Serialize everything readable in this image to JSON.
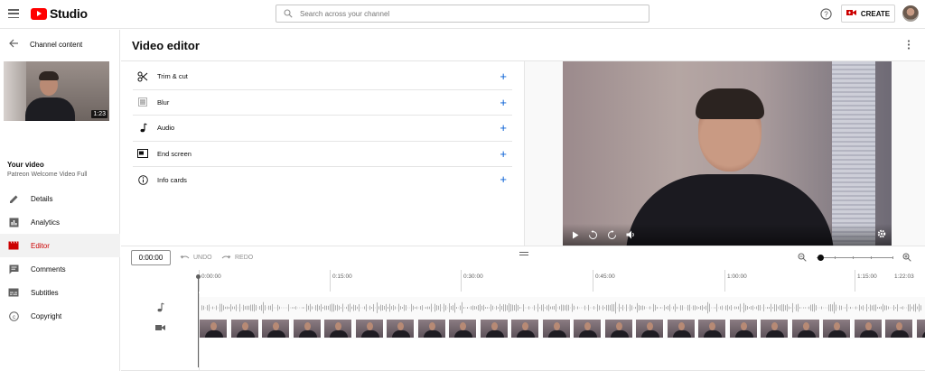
{
  "header": {
    "app_name": "Studio",
    "search_placeholder": "Search across your channel",
    "create_label": "CREATE"
  },
  "sidebar": {
    "back_label": "Channel content",
    "thumbnail_duration": "1:23",
    "your_video_label": "Your video",
    "video_title": "Patreon Welcome Video Full",
    "items": [
      {
        "label": "Details",
        "icon": "pencil-icon"
      },
      {
        "label": "Analytics",
        "icon": "analytics-icon"
      },
      {
        "label": "Editor",
        "icon": "clapperboard-icon",
        "active": true
      },
      {
        "label": "Comments",
        "icon": "comment-icon"
      },
      {
        "label": "Subtitles",
        "icon": "subtitles-icon"
      },
      {
        "label": "Copyright",
        "icon": "copyright-icon"
      }
    ]
  },
  "editor": {
    "title": "Video editor",
    "tools": [
      {
        "label": "Trim & cut",
        "icon": "scissors-icon"
      },
      {
        "label": "Blur",
        "icon": "blur-grid-icon"
      },
      {
        "label": "Audio",
        "icon": "music-note-icon"
      },
      {
        "label": "End screen",
        "icon": "end-screen-icon"
      },
      {
        "label": "Info cards",
        "icon": "info-icon"
      }
    ],
    "timecode": "0:00:00",
    "undo_label": "UNDO",
    "redo_label": "REDO",
    "ruler_ticks": [
      "0:00:00",
      "0:15:00",
      "0:30:00",
      "0:45:00",
      "1:00:00",
      "1:15:00",
      "1:22:03"
    ]
  },
  "colors": {
    "brand_red": "#ff0000",
    "active_red": "#cc0000",
    "accent_blue": "#065fd4"
  }
}
